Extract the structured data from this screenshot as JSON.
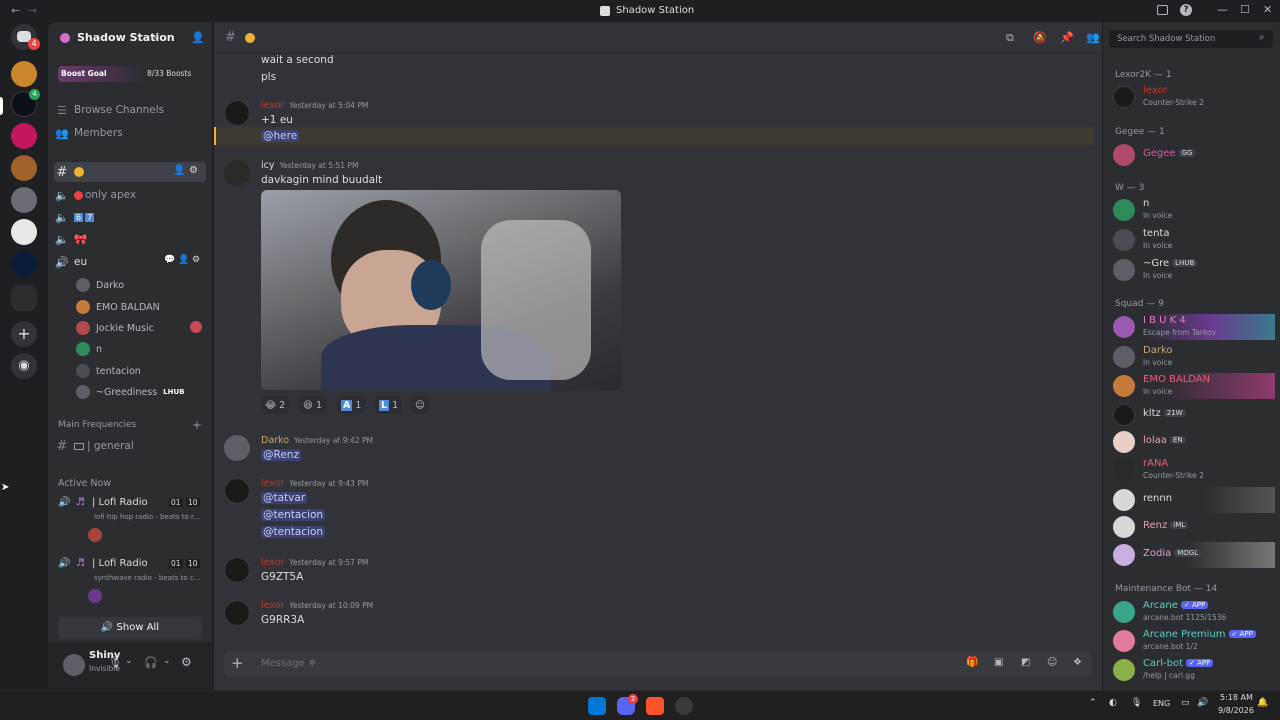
{
  "window": {
    "title": "Shadow Station",
    "nav_back": "←",
    "nav_fwd": "→",
    "minimize": "—",
    "maximize": "☐",
    "close": "✕"
  },
  "guilds": {
    "home_badge": "4",
    "server_badge": "4"
  },
  "server": {
    "name": "Shadow Station",
    "boost_label": "Boost Goal",
    "boost_count": "8/33 Boosts"
  },
  "sidebar": {
    "browse": "Browse Channels",
    "members": "Members",
    "channels": [
      {
        "label": ""
      },
      {
        "label": "only apex"
      },
      {
        "label": ""
      },
      {
        "label": ""
      },
      {
        "label": "eu"
      }
    ],
    "voice_users": [
      "Darko",
      "EMO BALDAN",
      "Jockie Music",
      "n",
      "tentacion",
      "~Greediness"
    ],
    "greediness_tag": "LHUB",
    "category": "Main Frequencies",
    "general": "| general",
    "active_now": "Active Now",
    "activities": [
      {
        "title": "| Lofi Radio",
        "sub": "lofi hip hop radio - beats to r...",
        "c1": "01",
        "c2": "10"
      },
      {
        "title": "| Lofi Radio",
        "sub": "synthwave radio - beats to c...",
        "c1": "01",
        "c2": "10"
      }
    ],
    "show_all": "Show All"
  },
  "user": {
    "name": "Shiny",
    "status": "Invisible"
  },
  "chat": {
    "search_placeholder": "Search Shadow Station",
    "messages": [
      {
        "lines": [
          "wait a second",
          "pls"
        ]
      },
      {
        "author": "lexor",
        "time": "Yesterday at 5:04 PM",
        "lines": [
          "+1 eu"
        ],
        "mention": "@here"
      },
      {
        "author": "icy",
        "time": "Yesterday at 5:51 PM",
        "lines": [
          "davkagin mind buudalt"
        ]
      },
      {
        "author": "Darko",
        "time": "Yesterday at 9:42 PM",
        "mention": "@Renz"
      },
      {
        "author": "lexor",
        "time": "Yesterday at 9:43 PM",
        "mentions": [
          "@tatvar",
          "@tentacion",
          "@tentacion"
        ]
      },
      {
        "author": "lexor",
        "time": "Yesterday at 9:57 PM",
        "lines": [
          "G9ZT5A"
        ]
      },
      {
        "author": "lexor",
        "time": "Yesterday at 10:09 PM",
        "lines": [
          "G9RR3A"
        ]
      }
    ],
    "reactions": [
      {
        "emoji": "😂",
        "count": "2"
      },
      {
        "emoji": "😆",
        "count": "1"
      },
      {
        "emoji": "A",
        "count": "1"
      },
      {
        "emoji": "L",
        "count": "1"
      }
    ],
    "input_placeholder": "Message #"
  },
  "members": {
    "groups": [
      {
        "title": "Lexor2K — 1"
      },
      {
        "title": "Gegee — 1"
      },
      {
        "title": "W — 3"
      },
      {
        "title": "Squad — 9"
      },
      {
        "title": "Maintenance Bot — 14"
      }
    ],
    "list": [
      {
        "name": "lexor",
        "status": "Counter-Strike 2"
      },
      {
        "name": "Gegee",
        "tag": "GG"
      },
      {
        "name": "n",
        "status": "In voice"
      },
      {
        "name": "tenta",
        "status": "In voice"
      },
      {
        "name": "~Gre",
        "tag": "LHUB",
        "status": "In voice"
      },
      {
        "name": "I B U K 4",
        "status": "Escape from Tarkov"
      },
      {
        "name": "Darko",
        "status": "In voice"
      },
      {
        "name": "EMO BALDAN",
        "status": "In voice"
      },
      {
        "name": "kltz",
        "tag": "21W"
      },
      {
        "name": "lolaa",
        "tag": "EN"
      },
      {
        "name": "rANA",
        "status": "Counter-Strike 2"
      },
      {
        "name": "rennn"
      },
      {
        "name": "Renz",
        "tag": "iML"
      },
      {
        "name": "Zodia",
        "tag": "MOGL"
      },
      {
        "name": "Arcane",
        "tag": "✓ APP",
        "status": "arcane.bot 1125/1536"
      },
      {
        "name": "Arcane Premium",
        "tag": "✓ APP",
        "status": "arcane.bot 1/2"
      },
      {
        "name": "Carl-bot",
        "tag": "✓ APP",
        "status": "/help | carl.gg"
      }
    ]
  },
  "taskbar": {
    "lang": "ENG",
    "time": "5:18 AM",
    "date": "9/8/2026",
    "discord_badge": "2"
  }
}
